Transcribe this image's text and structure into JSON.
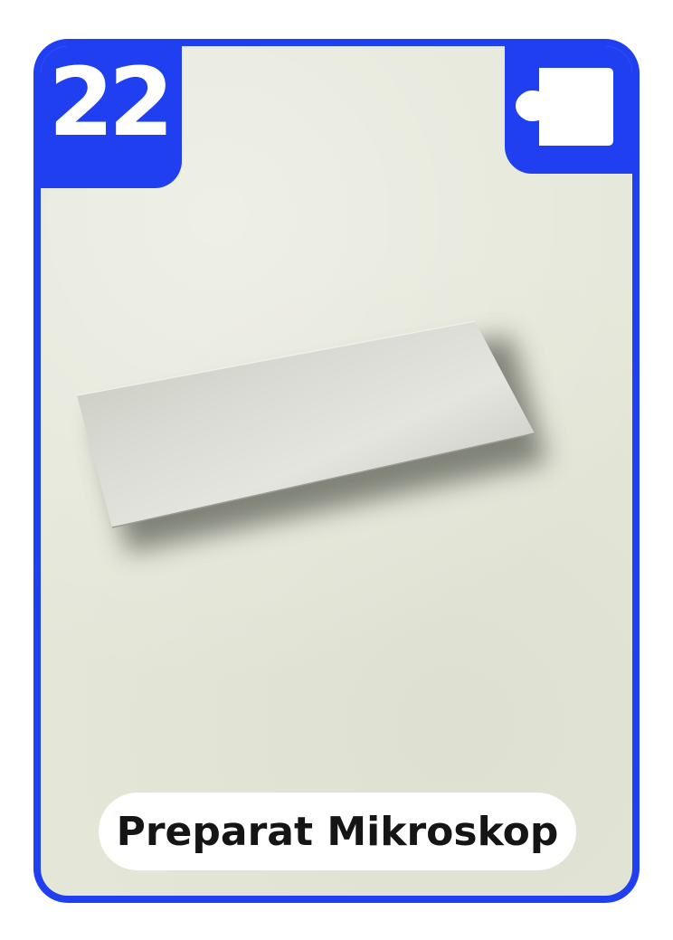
{
  "card": {
    "number": "22",
    "title": "Preparat Mikroskop",
    "accent_color": "#1f3ff0",
    "background_color": "#e5e7d9"
  },
  "icons": {
    "corner_icon": "puzzle-piece-icon",
    "illustration": "microscope-slide"
  }
}
